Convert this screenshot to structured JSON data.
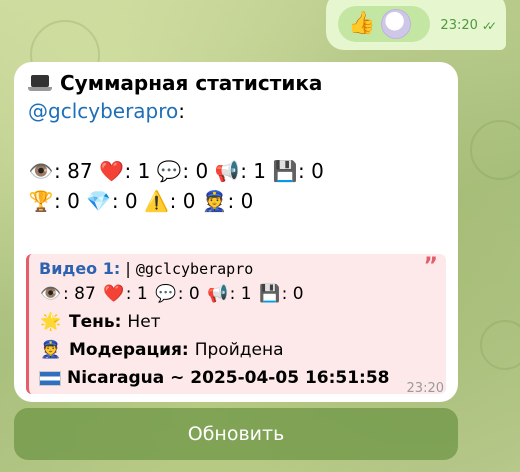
{
  "outgoing": {
    "reaction_emoji": "👍",
    "time": "23:20",
    "read_status": "✓✓"
  },
  "message": {
    "title": "Суммарная статистика",
    "mention": "@gclcyberapro",
    "mention_suffix": ":",
    "stats_row1": [
      {
        "icon": "👁️",
        "value": ": 87"
      },
      {
        "icon": "❤️",
        "value": ": 1"
      },
      {
        "icon": "💬",
        "value": ": 0"
      },
      {
        "icon": "📢",
        "value": ": 1"
      },
      {
        "icon": "💾",
        "value": ": 0"
      }
    ],
    "stats_row2": [
      {
        "icon": "🏆",
        "value": ": 0"
      },
      {
        "icon": "💎",
        "value": ": 0"
      },
      {
        "icon": "⚠️",
        "value": ": 0"
      },
      {
        "icon": "👮",
        "value": ": 0"
      }
    ],
    "quote": {
      "video_label": "Видео 1:",
      "separator": "|",
      "handle": "@gclcyberapro",
      "stats": [
        {
          "icon": "👁️",
          "value": ": 87"
        },
        {
          "icon": "❤️",
          "value": ": 1"
        },
        {
          "icon": "💬",
          "value": ": 0"
        },
        {
          "icon": "📢",
          "value": ": 1"
        },
        {
          "icon": "💾",
          "value": ": 0"
        }
      ],
      "shadow_label": "Тень:",
      "shadow_value": "Нет",
      "moderation_label": "Модерация:",
      "moderation_value": "Пройдена",
      "location_line": "Nicaragua ~ 2025-04-05 16:51:58"
    },
    "time": "23:20"
  },
  "button": {
    "label": "Обновить"
  }
}
